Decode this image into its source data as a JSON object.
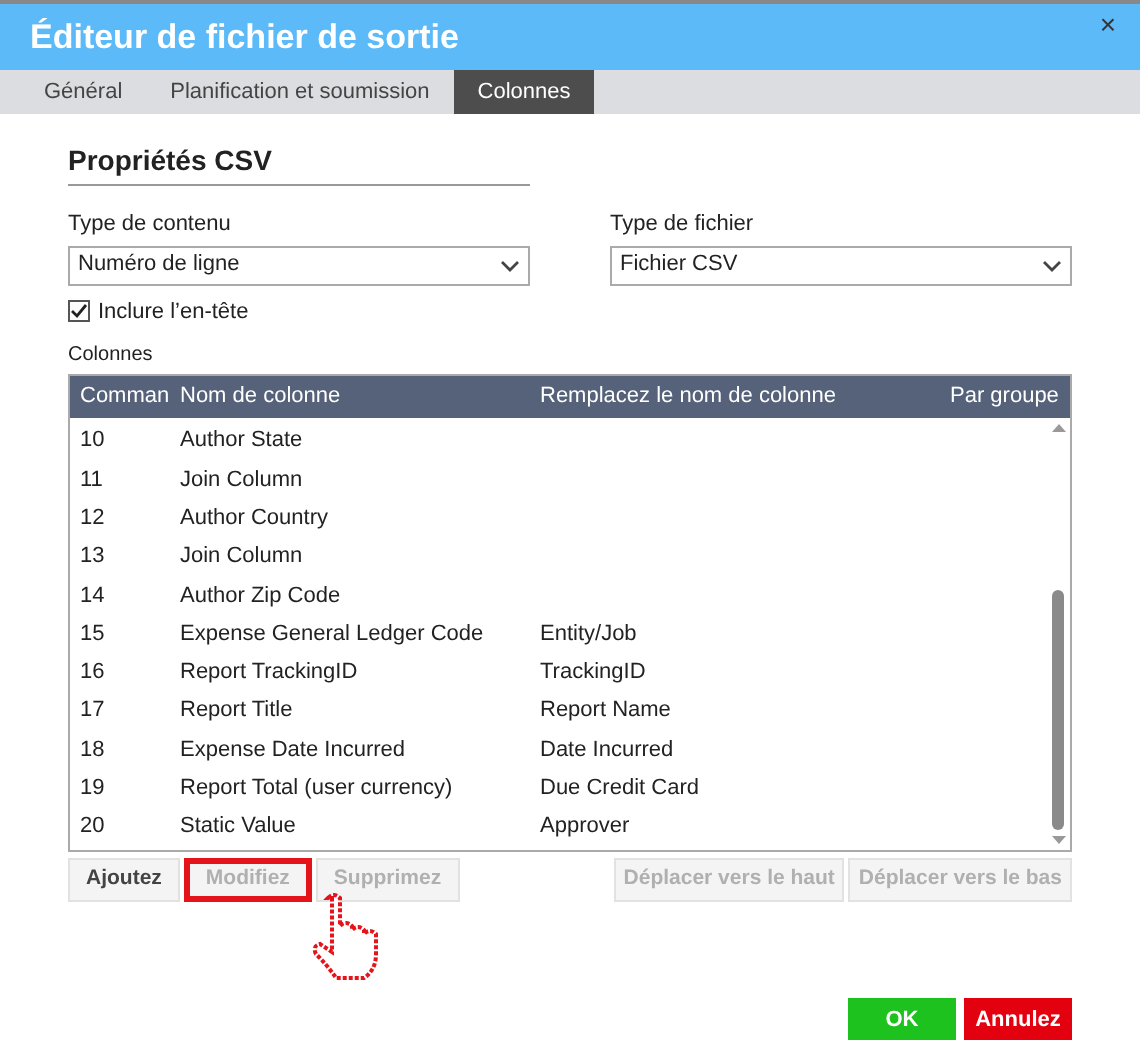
{
  "window": {
    "title": "Éditeur de fichier de sortie",
    "close": "×"
  },
  "tabs": [
    {
      "label": "Général",
      "selected": false
    },
    {
      "label": "Planification et soumission",
      "selected": false
    },
    {
      "label": "Colonnes",
      "selected": true
    }
  ],
  "section_title": "Propriétés CSV",
  "content_type": {
    "label": "Type de contenu",
    "value": "Numéro de ligne"
  },
  "file_type": {
    "label": "Type de fichier",
    "value": "Fichier CSV"
  },
  "include_header": {
    "label": "Inclure l’en-tête",
    "checked": true
  },
  "columns_label": "Colonnes",
  "table": {
    "columns": [
      "Comman",
      "Nom de colonne",
      "Remplacez le nom de colonne",
      "Par groupe"
    ],
    "rows": [
      [
        "10",
        "Author State",
        ""
      ],
      [
        "11",
        "Join Column",
        ""
      ],
      [
        "12",
        "Author Country",
        ""
      ],
      [
        "13",
        "Join Column",
        ""
      ],
      [
        "14",
        "Author Zip Code",
        ""
      ],
      [
        "15",
        "Expense General Ledger Code",
        "Entity/Job"
      ],
      [
        "16",
        "Report TrackingID",
        "TrackingID"
      ],
      [
        "17",
        "Report Title",
        "Report Name"
      ],
      [
        "18",
        "Expense Date Incurred",
        "Date Incurred"
      ],
      [
        "19",
        "Report Total (user currency)",
        "Due Credit Card"
      ],
      [
        "20",
        "Static Value",
        "Approver"
      ]
    ]
  },
  "row_buttons": [
    {
      "label": "Ajoutez",
      "disabled": false,
      "highlighted": false
    },
    {
      "label": "Modifiez",
      "disabled": true,
      "highlighted": true
    },
    {
      "label": "Supprimez",
      "disabled": true,
      "highlighted": false
    }
  ],
  "move_buttons": [
    {
      "label": "Déplacer vers le haut",
      "disabled": true
    },
    {
      "label": "Déplacer vers le bas",
      "disabled": true
    }
  ],
  "dialog_buttons": [
    {
      "label": "OK",
      "kind": "confirm"
    },
    {
      "label": "Annulez",
      "kind": "cancel"
    }
  ]
}
